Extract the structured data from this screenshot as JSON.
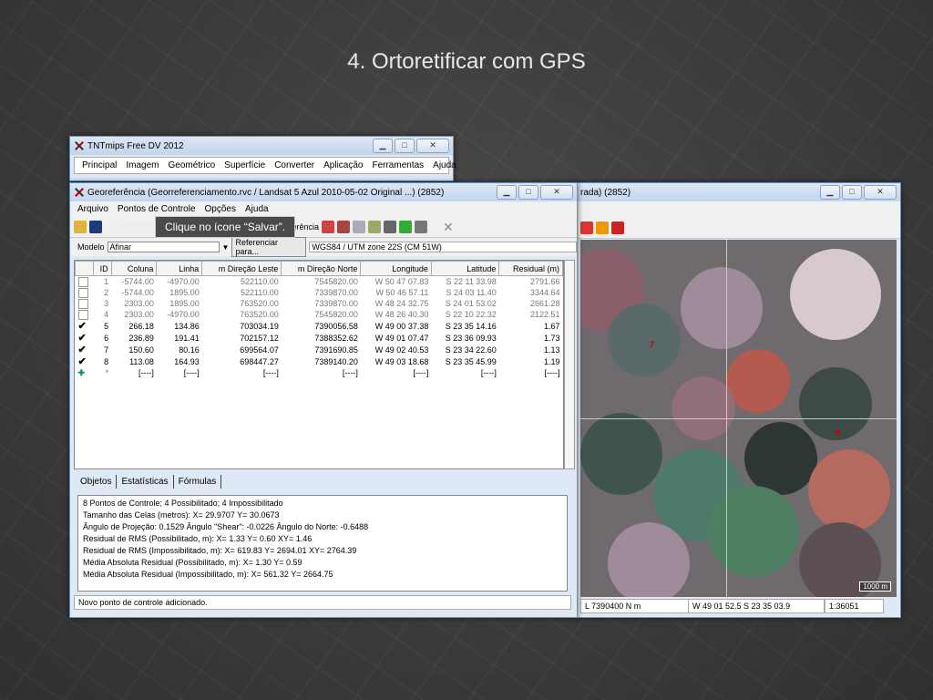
{
  "slide": {
    "title": "4. Ortoretificar com GPS"
  },
  "main_window": {
    "title": "TNTmips Free DV 2012",
    "menu": [
      "Principal",
      "Imagem",
      "Geométrico",
      "Superfície",
      "Converter",
      "Aplicação",
      "Ferramentas",
      "Ajuda"
    ]
  },
  "geo_window": {
    "title": "Georeferência (Georreferenciamento.rvc / Landsat 5 Azul 2010-05-02 Original ...) (2852)",
    "menu": [
      "Arquivo",
      "Pontos de Controle",
      "Opções",
      "Ajuda"
    ],
    "toolbar_text": "ferência",
    "model_label": "Modelo",
    "model_value": "Afinar",
    "ref_button": "Referenciar para...",
    "crs": "WGS84 / UTM zone 22S (CM 51W)",
    "columns": [
      "ID",
      "Coluna",
      "Linha",
      "m Direção Leste",
      "m Direção Norte",
      "Longitude",
      "Latitude",
      "Residual (m)"
    ],
    "rows": [
      {
        "id": "1",
        "col": "-5744.00",
        "lin": "-4970.00",
        "e": "522110.00",
        "n": "7545820.00",
        "lon": "W 50 47 07.83",
        "lat": "S 22 11 33.98",
        "res": "2791.66",
        "on": false
      },
      {
        "id": "2",
        "col": "-5744.00",
        "lin": "1895.00",
        "e": "522110.00",
        "n": "7339870.00",
        "lon": "W 50 46 57.11",
        "lat": "S 24 03 11.40",
        "res": "3344.64",
        "on": false
      },
      {
        "id": "3",
        "col": "2303.00",
        "lin": "1895.00",
        "e": "763520.00",
        "n": "7339870.00",
        "lon": "W 48 24 32.75",
        "lat": "S 24 01 53.02",
        "res": "2661.28",
        "on": false
      },
      {
        "id": "4",
        "col": "2303.00",
        "lin": "-4970.00",
        "e": "763520.00",
        "n": "7545820.00",
        "lon": "W 48 26 40.30",
        "lat": "S 22 10 22.32",
        "res": "2122.51",
        "on": false
      },
      {
        "id": "5",
        "col": "266.18",
        "lin": "134.86",
        "e": "703034.19",
        "n": "7390056.58",
        "lon": "W 49 00 37.38",
        "lat": "S 23 35 14.16",
        "res": "1.67",
        "on": true
      },
      {
        "id": "6",
        "col": "236.89",
        "lin": "191.41",
        "e": "702157.12",
        "n": "7388352.62",
        "lon": "W 49 01 07.47",
        "lat": "S 23 36 09.93",
        "res": "1.73",
        "on": true
      },
      {
        "id": "7",
        "col": "150.60",
        "lin": "80.16",
        "e": "699564.07",
        "n": "7391690.85",
        "lon": "W 49 02 40.53",
        "lat": "S 23 34 22.60",
        "res": "1.13",
        "on": true
      },
      {
        "id": "8",
        "col": "113.08",
        "lin": "164.93",
        "e": "698447.27",
        "n": "7389140.20",
        "lon": "W 49 03 18.68",
        "lat": "S 23 35 45.99",
        "res": "1.19",
        "on": true
      }
    ],
    "new_row": {
      "id": "*",
      "placeholder": "[----]"
    },
    "tabs": [
      "Objetos",
      "Estatísticas",
      "Fórmulas"
    ],
    "stats": [
      "8 Pontos de Controle;  4 Possibilitado;  4 Impossibilitado",
      "Tamanho das Celas (metros):  X= 29.9707  Y= 30.0673",
      "Ângulo de Projeção: 0.1529  Ângulo \"Shear\": -0.0226  Ângulo do Norte: -0.6488",
      "Residual de RMS (Possibilitado, m):  X= 1.33  Y= 0.60  XY= 1.46",
      "Residual de RMS (Impossibilitado, m):  X= 619.83  Y= 2694.01  XY= 2764.39",
      "Média Absoluta Residual (Possibilitado, m):  X= 1.30  Y= 0.59",
      "Média Absoluta Residual (Impossibilitado, m):  X= 561.32  Y= 2664.75"
    ],
    "status": "Novo ponto de controle adicionado."
  },
  "ref_window": {
    "title": "rada) (2852)",
    "status_n": "L  7390400 N m",
    "status_coord": "W 49 01 52.5  S 23 35 03.9",
    "status_scale": "1:36051",
    "scalebar": "1000 m",
    "markers": [
      "7",
      "8"
    ]
  },
  "callout": {
    "text": "Clique no ícone “Salvar”."
  }
}
